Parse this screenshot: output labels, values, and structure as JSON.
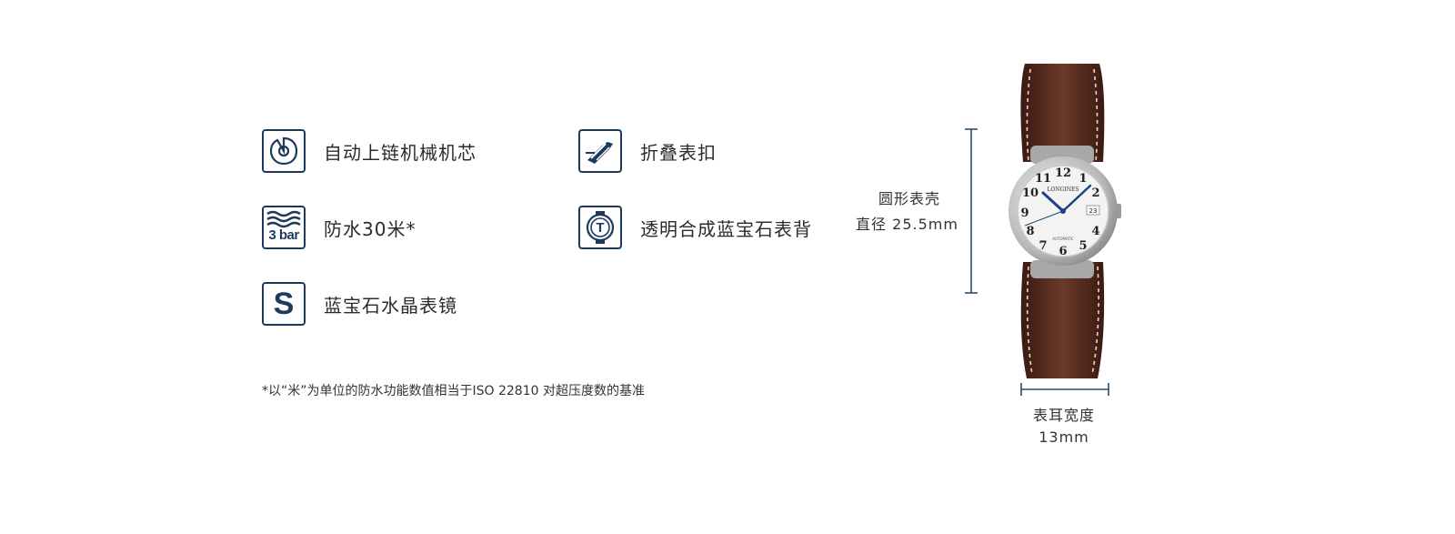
{
  "features": [
    {
      "label": "自动上链机械机芯",
      "icon": "automatic-rotor-icon"
    },
    {
      "label": "折叠表扣",
      "icon": "folding-clasp-icon"
    },
    {
      "label": "防水30米*",
      "icon": "water-resistance-3bar-icon",
      "icon_text": "3 bar"
    },
    {
      "label": "透明合成蓝宝石表背",
      "icon": "sapphire-caseback-icon",
      "icon_text": "T"
    },
    {
      "label": "蓝宝石水晶表镜",
      "icon": "sapphire-crystal-icon",
      "icon_text": "S"
    }
  ],
  "footnote": "*以“米”为单位的防水功能数值相当于ISO 22810 对超压度数的基准",
  "case": {
    "shape_label": "圆形表壳",
    "diameter_label": "直径 25.5mm"
  },
  "lug": {
    "width_label": "表耳宽度",
    "width_value": "13mm"
  },
  "watch": {
    "brand": "LONGINES",
    "dial_text": "AUTOMATIC",
    "date": "23",
    "numerals": [
      "12",
      "1",
      "2",
      "4",
      "5",
      "6",
      "7",
      "8",
      "9",
      "10",
      "11"
    ]
  },
  "colors": {
    "icon_navy": "#1d3a5c",
    "dim_line": "#2f4a6b",
    "strap": "#4a2419"
  }
}
